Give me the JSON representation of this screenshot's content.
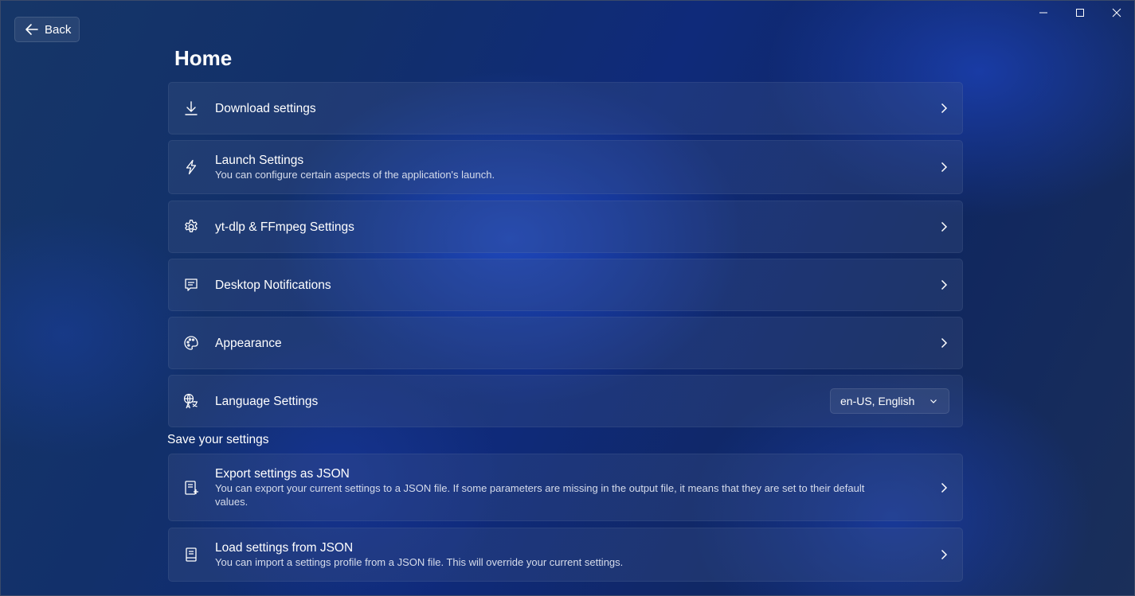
{
  "window": {
    "back_label": "Back",
    "page_title": "Home"
  },
  "cards": [
    {
      "title": "Download settings",
      "description": "",
      "icon": "download-icon"
    },
    {
      "title": "Launch Settings",
      "description": "You can configure certain aspects of the application's launch.",
      "icon": "lightning-icon"
    },
    {
      "title": "yt-dlp & FFmpeg Settings",
      "description": "",
      "icon": "gear-icon"
    },
    {
      "title": "Desktop Notifications",
      "description": "",
      "icon": "notification-icon"
    },
    {
      "title": "Appearance",
      "description": "",
      "icon": "palette-icon"
    },
    {
      "title": "Language Settings",
      "description": "",
      "icon": "language-icon",
      "dropdown_value": "en-US, English"
    }
  ],
  "save_section": {
    "label": "Save your settings",
    "cards": [
      {
        "title": "Export settings as JSON",
        "description": "You can export your current settings to a JSON file. If some parameters are missing in the output file, it means that they are set to their default values.",
        "icon": "export-icon"
      },
      {
        "title": "Load settings from JSON",
        "description": "You can import a settings profile from a JSON file. This will override your current settings.",
        "icon": "import-icon"
      }
    ]
  },
  "colors": {
    "background": "#12306a",
    "card": "#3a4f7a",
    "text": "#ffffff"
  }
}
